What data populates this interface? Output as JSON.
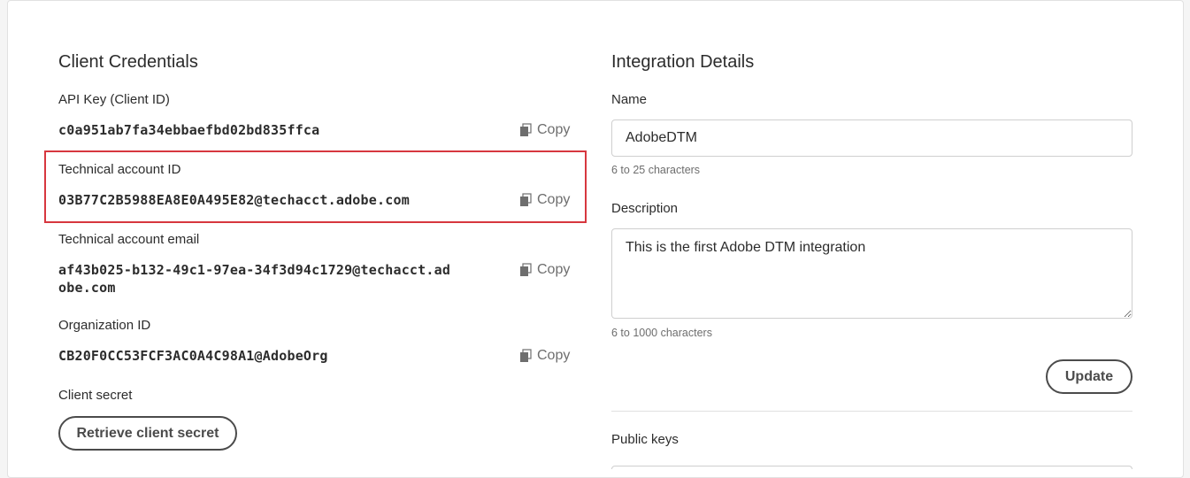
{
  "client_credentials": {
    "title": "Client Credentials",
    "copy_label": "Copy",
    "api_key": {
      "label": "API Key (Client ID)",
      "value": "c0a951ab7fa34ebbaefbd02bd835ffca"
    },
    "technical_account_id": {
      "label": "Technical account ID",
      "value": "03B77C2B5988EA8E0A495E82@techacct.adobe.com"
    },
    "technical_account_email": {
      "label": "Technical account email",
      "value_line1": "af43b025-b132-49c1-97ea-34f3d94c1729@techacct.ad",
      "value_line2": "obe.com"
    },
    "organization_id": {
      "label": "Organization ID",
      "value": "CB20F0CC53FCF3AC0A4C98A1@AdobeOrg"
    },
    "client_secret": {
      "label": "Client secret",
      "button_label": "Retrieve client secret"
    }
  },
  "integration_details": {
    "title": "Integration Details",
    "name": {
      "label": "Name",
      "value": "AdobeDTM",
      "hint": "6 to 25 characters"
    },
    "description": {
      "label": "Description",
      "value": "This is the first Adobe DTM integration",
      "hint": "6 to 1000 characters"
    },
    "update_button": "Update",
    "public_keys_label": "Public keys"
  },
  "colors": {
    "highlight": "#d7373f",
    "text": "#2c2c2c",
    "muted": "#6e6e6e",
    "border": "#cfcfcf"
  }
}
